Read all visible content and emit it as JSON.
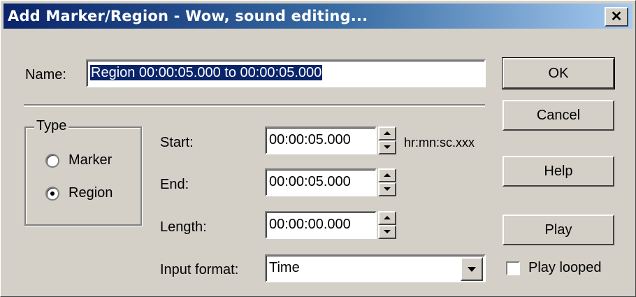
{
  "window": {
    "title": "Add Marker/Region - Wow, sound editing...",
    "close_symbol": "✕"
  },
  "name": {
    "label": "Name:",
    "value": "Region 00:00:05.000 to 00:00:05.000"
  },
  "type_group": {
    "title": "Type",
    "options": [
      {
        "label": "Marker",
        "selected": false
      },
      {
        "label": "Region",
        "selected": true
      }
    ]
  },
  "times": {
    "start": {
      "label": "Start:",
      "value": "00:00:05.000"
    },
    "end": {
      "label": "End:",
      "value": "00:00:05.000"
    },
    "length": {
      "label": "Length:",
      "value": "00:00:00.000"
    },
    "format_hint": "hr:mn:sc.xxx"
  },
  "input_format": {
    "label": "Input format:",
    "selected": "Time"
  },
  "buttons": {
    "ok": "OK",
    "cancel": "Cancel",
    "help": "Help",
    "play": "Play"
  },
  "play_looped": {
    "label": "Play looped",
    "checked": false
  },
  "colors": {
    "face": "#d4d0c8",
    "title_start": "#0a246a",
    "title_end": "#a6caf0",
    "selection": "#0a246a"
  }
}
